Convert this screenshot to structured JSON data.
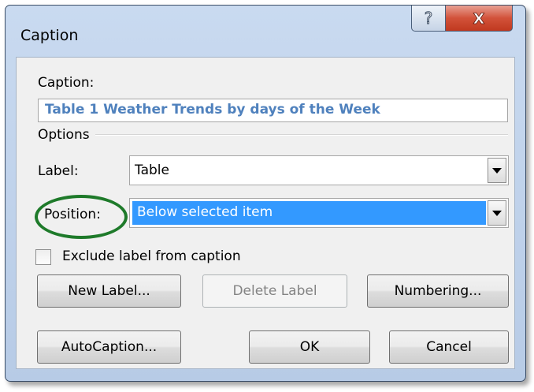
{
  "dialog": {
    "title": "Caption",
    "help_glyph": "?",
    "close_glyph": "X",
    "caption_label": "Caption:",
    "caption_value": "Table 1 Weather Trends by days of the Week",
    "options_label": "Options",
    "label_label": "Label:",
    "label_value": "Table",
    "position_label": "Position:",
    "position_value": "Below selected item",
    "exclude_label": "Exclude label from caption",
    "exclude_checked": false,
    "new_label_button": "New Label...",
    "delete_label_button": "Delete Label",
    "numbering_button": "Numbering...",
    "autocaption_button": "AutoCaption...",
    "ok_button": "OK",
    "cancel_button": "Cancel"
  },
  "colors": {
    "caption_text": "#4f81bd",
    "selection": "#3399ff",
    "highlight_ellipse": "#1e7a2a",
    "close_button": "#c0391f"
  }
}
